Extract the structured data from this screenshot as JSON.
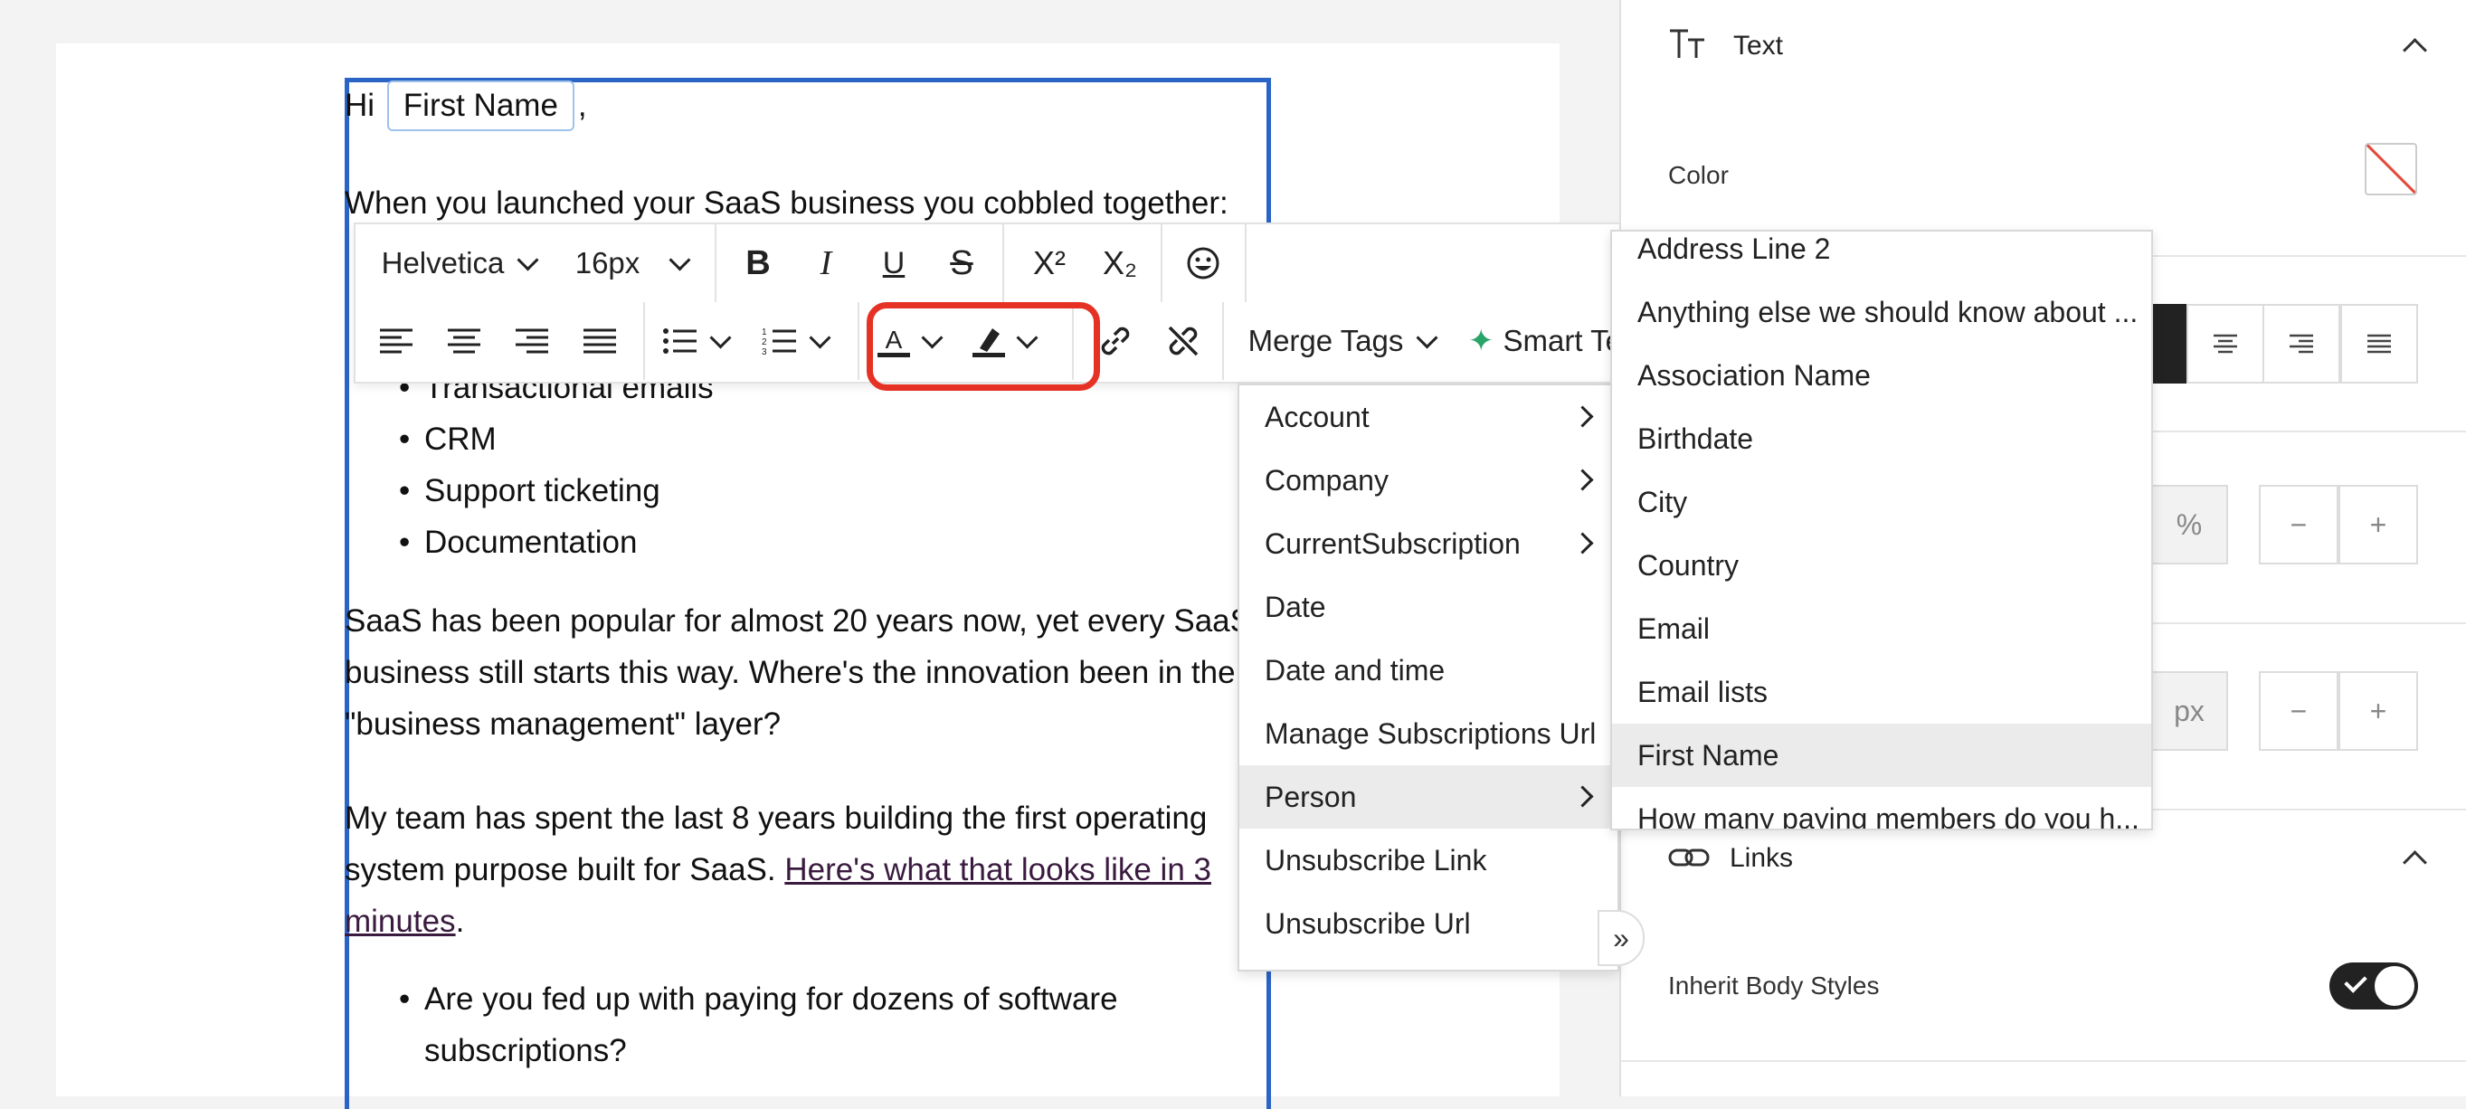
{
  "email": {
    "greeting_prefix": "Hi",
    "merge_chip": "First Name",
    "greeting_suffix": ",",
    "intro": "When you launched your SaaS business you cobbled together:",
    "hidden_bullet": "Transactional emails",
    "bullets": [
      "CRM",
      "Support ticketing",
      "Documentation"
    ],
    "para2_line1": "SaaS has been popular for almost 20 years now, yet every SaaS",
    "para2_line2": "business still starts this way. Where's the innovation been in the",
    "para2_line3": "\"business management\" layer?",
    "para3_line1": "My team has spent the last 8 years building the first operating",
    "para3_line2_text": "system purpose built for SaaS. ",
    "para3_link_part1": "Here's what that looks like in 3",
    "para3_link_part2": "minutes",
    "para3_end": ".",
    "bullets2_line1": "Are you fed up with paying for dozens of software",
    "bullets2_line2": "subscriptions?"
  },
  "toolbar": {
    "font_family": "Helvetica",
    "font_size": "16px",
    "merge_tags": "Merge Tags",
    "smart": "Smart Te"
  },
  "merge_menu": [
    {
      "label": "Account",
      "submenu": true
    },
    {
      "label": "Company",
      "submenu": true
    },
    {
      "label": "CurrentSubscription",
      "submenu": true
    },
    {
      "label": "Date",
      "submenu": false
    },
    {
      "label": "Date and time",
      "submenu": false
    },
    {
      "label": "Manage Subscriptions Url",
      "submenu": false
    },
    {
      "label": "Person",
      "submenu": true,
      "selected": true
    },
    {
      "label": "Unsubscribe Link",
      "submenu": false
    },
    {
      "label": "Unsubscribe Url",
      "submenu": false
    }
  ],
  "person_menu": [
    "Address Line 2",
    "Anything else we should know about ...",
    "Association Name",
    "Birthdate",
    "City",
    "Country",
    "Email",
    "Email lists",
    "First Name",
    "How many paying members do you h..."
  ],
  "person_selected": "First Name",
  "panel": {
    "text_section": "Text",
    "color_label": "Color",
    "unit_percent": "%",
    "unit_px": "px",
    "minus": "−",
    "plus": "+",
    "links_section": "Links",
    "inherit_label": "Inherit Body Styles"
  }
}
